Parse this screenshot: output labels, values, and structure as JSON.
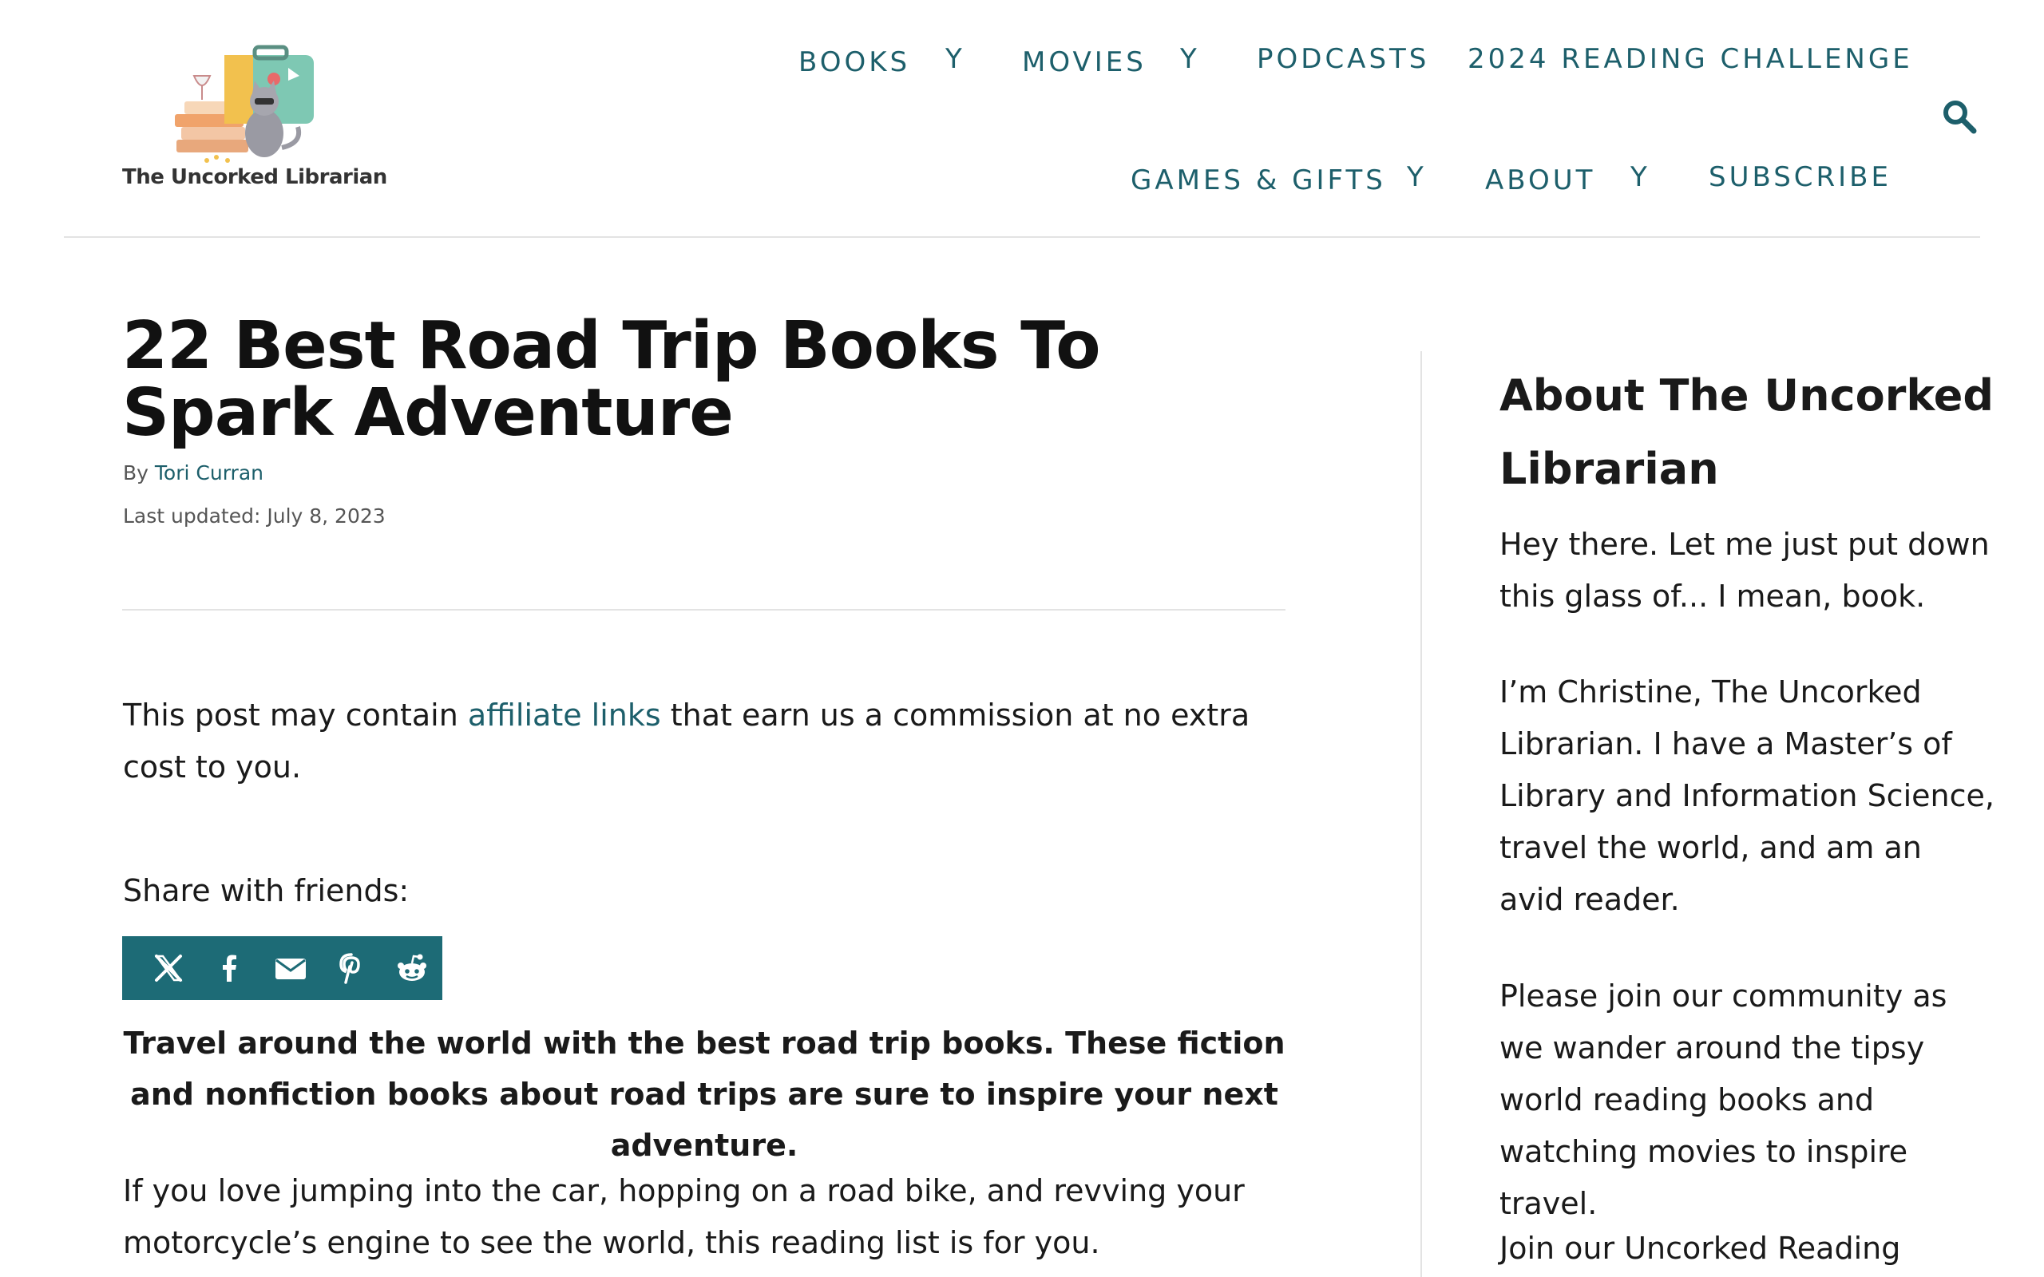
{
  "site": {
    "logo_text": "The Uncorked Librarian"
  },
  "nav": {
    "books": "BOOKS",
    "movies": "MOVIES",
    "podcasts": "PODCASTS",
    "reading_challenge": "2024 READING CHALLENGE",
    "games_gifts": "GAMES & GIFTS",
    "about": "ABOUT",
    "subscribe": "SUBSCRIBE",
    "caret": "Y"
  },
  "article": {
    "title": "22 Best Road Trip Books To Spark Adventure",
    "by": "By",
    "author": "Tori Curran",
    "last_updated": "Last updated: July 8, 2023",
    "disclosure_before": "This post may contain ",
    "disclosure_link": "affiliate links",
    "disclosure_after": " that earn us a commission at no extra cost to you.",
    "share_label": "Share with friends:",
    "intro_bold": "Travel around the world with the best road trip books. These fiction and nonfiction books about road trips are sure to inspire your next adventure.",
    "body_first": "If you love jumping into the car, hopping on a road bike, and revving your motorcycle’s engine to see the world, this reading list is for you."
  },
  "share_icons": [
    "x-icon",
    "facebook-icon",
    "email-icon",
    "pinterest-icon",
    "reddit-icon"
  ],
  "sidebar": {
    "title": "About The Uncorked Librarian",
    "p1": "Hey there. Let me just put down this glass of... I mean, book.",
    "p2": "I’m Christine, The Uncorked Librarian. I have a Master’s of Library and Information Science, travel the world, and am an avid reader.",
    "p3": "Please join our community as we wander around the tipsy world reading books and watching movies to inspire travel.",
    "p4": "Join our Uncorked Reading"
  },
  "colors": {
    "accent": "#1d5f6b",
    "share_bar": "#1d6b76",
    "text": "#1a1a1a"
  }
}
